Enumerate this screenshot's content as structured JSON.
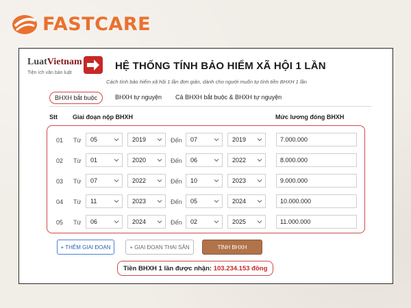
{
  "brand": {
    "name": "FASTCARE"
  },
  "logo": {
    "name_a": "Luat",
    "name_b": "Vietnam",
    "tagline": "Tiện ích văn bản luật"
  },
  "header": {
    "title": "HỆ THỐNG TÍNH BẢO HIỂM XÃ HỘI 1 LẦN",
    "subtitle": "Cách tính bảo hiểm xã hội 1 lần đơn giản, dành cho người muốn tự tính tiền BHXH 1 lần"
  },
  "tabs": [
    "BHXH bắt buộc",
    "BHXH tự nguyện",
    "Cả BHXH bắt buộc & BHXH tự nguyện"
  ],
  "columns": {
    "stt": "Stt",
    "period": "Giai đoạn nộp BHXH",
    "salary": "Mức lương đóng BHXH"
  },
  "labels": {
    "from": "Từ",
    "to": "Đến"
  },
  "rows": [
    {
      "stt": "01",
      "from_month": "05",
      "from_year": "2019",
      "to_month": "07",
      "to_year": "2019",
      "salary": "7.000.000"
    },
    {
      "stt": "02",
      "from_month": "01",
      "from_year": "2020",
      "to_month": "06",
      "to_year": "2022",
      "salary": "8.000.000"
    },
    {
      "stt": "03",
      "from_month": "07",
      "from_year": "2022",
      "to_month": "10",
      "to_year": "2023",
      "salary": "9.000.000"
    },
    {
      "stt": "04",
      "from_month": "11",
      "from_year": "2023",
      "to_month": "05",
      "to_year": "2024",
      "salary": "10.000.000"
    },
    {
      "stt": "05",
      "from_month": "06",
      "from_year": "2024",
      "to_month": "02",
      "to_year": "2025",
      "salary": "11.000.000"
    }
  ],
  "buttons": {
    "add": "+ THÊM GIAI ĐOẠN",
    "maternity": "+ GIAI ĐOẠN THAI SẢN",
    "calc": "TÍNH BHXH"
  },
  "result": {
    "label": "Tiền BHXH 1 lần được nhận:",
    "amount": "103.234.153 đồng"
  },
  "colors": {
    "brand": "#e9712f",
    "accent": "#d04848",
    "calc_button": "#b0734a",
    "amount": "#c62828"
  }
}
